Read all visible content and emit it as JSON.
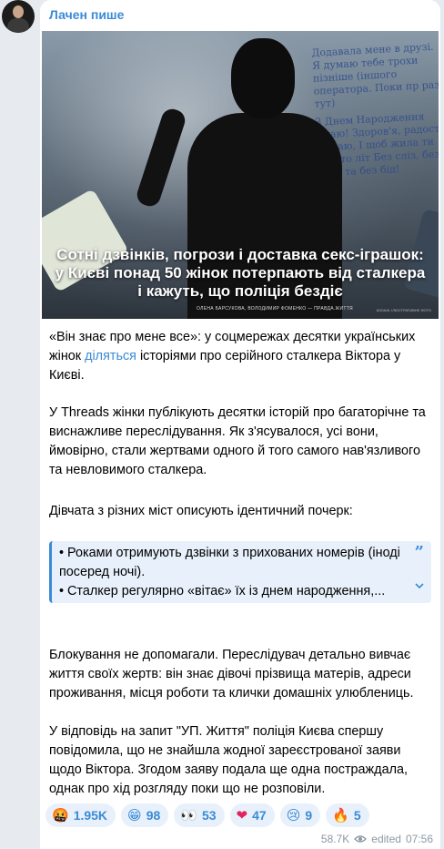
{
  "channel": {
    "author_name": "Лачен пише"
  },
  "media": {
    "headline": "Сотні дзвінків, погрози і доставка секс-іграшок: у Києві понад 50 жінок потерпають від сталкера і кажуть, що поліція бездіє",
    "credit": "ОЛЕНА БАРСУКОВА, ВОЛОДИМИР ФОМЕНКО — ПРАВДА.ЖИТТЯ",
    "illustration": "КОЛАЖ: ІЛЮСТРАТИВНЕ ФОТО",
    "chat_lines": [
      "Додавала мене в друзі. Я думаю тебе трохи пізніше (іншого оператора. Поки пр раз тут)",
      "З Днем Народження вітаю! Здоров'я, радості бажаю, І щоб жила ти багато літ Без сліз, без горя та без бід!"
    ]
  },
  "post": {
    "p1_before": "«Він знає про мене все»: у соцмережах десятки українських жінок ",
    "p1_link": "діляться",
    "p1_after": " історіями про серійного сталкера Віктора у Києві.",
    "p2": "У Threads жінки публікують десятки історій про багаторічне та виснажливе переслідування. Як з'ясувалося, усі вони, ймовірно, стали жертвами одного й того самого нав'язливого та невловимого сталкера.",
    "p3": "Дівчата з різних міст описують ідентичний почерк:",
    "quote_line1": "• Роками отримують дзвінки з прихованих номерів (іноді посеред ночі).",
    "quote_line2": "• Сталкер регулярно «вітає» їх із днем народження,...",
    "p4": "Блокування не допомагали. Переслідувач детально вивчає життя своїх жертв: він знає дівочі прізвища матерів, адреси проживання, місця роботи та клички домашніх улюблениць.",
    "p5": "У відповідь на запит \"УП. Життя\" поліція Києва спершу повідомила, що не знайшла жодної зареєстрованої заяви щодо Віктора. Згодом заяву подала ще одна постраждала, однак про хід розгляду поки що не розповіли."
  },
  "reactions": [
    {
      "emoji": "🤬",
      "count": "1.95K"
    },
    {
      "emoji": "😁",
      "count": "98"
    },
    {
      "emoji": "👀",
      "count": "53"
    },
    {
      "emoji": "❤",
      "count": "47"
    },
    {
      "emoji": "😢",
      "count": "9"
    },
    {
      "emoji": "🔥",
      "count": "5"
    }
  ],
  "meta": {
    "views": "58.7K",
    "edited_label": "edited",
    "time": "07:56"
  },
  "colors": {
    "accent": "#3a8bd6",
    "background": "#e7ebf0",
    "bubble": "#ffffff",
    "meta": "#8b98a5"
  }
}
